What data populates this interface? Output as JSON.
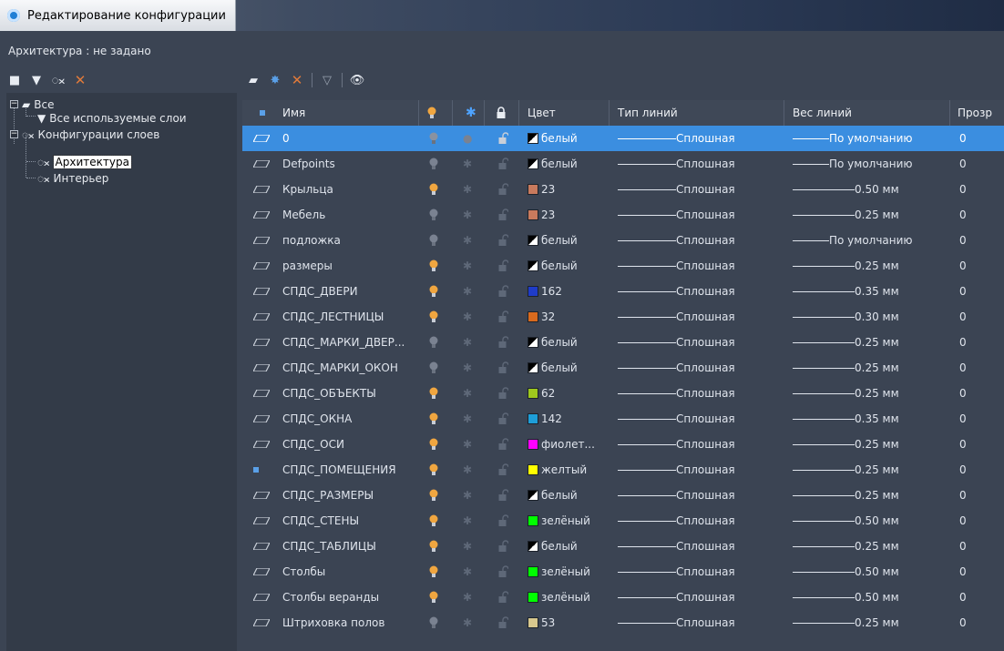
{
  "window": {
    "title": "Редактирование конфигурации"
  },
  "architecture_label": "Архитектура : не задано",
  "tree": {
    "all": "Все",
    "all_used": "Все используемые слои",
    "configs": "Конфигурации слоев",
    "arch": "Архитектура",
    "interior": "Интерьер"
  },
  "columns": {
    "name": "Имя",
    "color": "Цвет",
    "linetype": "Тип линий",
    "lineweight": "Вес линий",
    "transparency": "Прозр"
  },
  "colors": {
    "accent": "#3b8ee0",
    "bulb_on": "#f0a640",
    "bulb_off": "#7a8291"
  },
  "layers": [
    {
      "name": "0",
      "on": false,
      "color_name": "белый",
      "swatch": "#ffffff",
      "linetype": "Сплошная",
      "lineweight": "По умолчанию",
      "transp": "0",
      "selected": true,
      "current": false
    },
    {
      "name": "Defpoints",
      "on": false,
      "color_name": "белый",
      "swatch": "#ffffff",
      "linetype": "Сплошная",
      "lineweight": "По умолчанию",
      "transp": "0",
      "selected": false,
      "current": false
    },
    {
      "name": "Крыльца",
      "on": true,
      "color_name": "23",
      "swatch": "#c87a5d",
      "linetype": "Сплошная",
      "lineweight": "0.50 мм",
      "transp": "0",
      "selected": false,
      "current": false
    },
    {
      "name": "Мебель",
      "on": false,
      "color_name": "23",
      "swatch": "#c87a5d",
      "linetype": "Сплошная",
      "lineweight": "0.25 мм",
      "transp": "0",
      "selected": false,
      "current": false
    },
    {
      "name": "подложка",
      "on": false,
      "color_name": "белый",
      "swatch": "#ffffff",
      "linetype": "Сплошная",
      "lineweight": "По умолчанию",
      "transp": "0",
      "selected": false,
      "current": false
    },
    {
      "name": "размеры",
      "on": true,
      "color_name": "белый",
      "swatch": "#ffffff",
      "linetype": "Сплошная",
      "lineweight": "0.25 мм",
      "transp": "0",
      "selected": false,
      "current": false
    },
    {
      "name": "СПДС_ДВЕРИ",
      "on": true,
      "color_name": "162",
      "swatch": "#1f3cc8",
      "linetype": "Сплошная",
      "lineweight": "0.35 мм",
      "transp": "0",
      "selected": false,
      "current": false
    },
    {
      "name": "СПДС_ЛЕСТНИЦЫ",
      "on": true,
      "color_name": "32",
      "swatch": "#d86a1e",
      "linetype": "Сплошная",
      "lineweight": "0.30 мм",
      "transp": "0",
      "selected": false,
      "current": false
    },
    {
      "name": "СПДС_МАРКИ_ДВЕР...",
      "on": false,
      "color_name": "белый",
      "swatch": "#ffffff",
      "linetype": "Сплошная",
      "lineweight": "0.25 мм",
      "transp": "0",
      "selected": false,
      "current": false
    },
    {
      "name": "СПДС_МАРКИ_ОКОН",
      "on": false,
      "color_name": "белый",
      "swatch": "#ffffff",
      "linetype": "Сплошная",
      "lineweight": "0.25 мм",
      "transp": "0",
      "selected": false,
      "current": false
    },
    {
      "name": "СПДС_ОБЪЕКТЫ",
      "on": true,
      "color_name": "62",
      "swatch": "#9ec81e",
      "linetype": "Сплошная",
      "lineweight": "0.25 мм",
      "transp": "0",
      "selected": false,
      "current": false
    },
    {
      "name": "СПДС_ОКНА",
      "on": true,
      "color_name": "142",
      "swatch": "#1e9ed8",
      "linetype": "Сплошная",
      "lineweight": "0.35 мм",
      "transp": "0",
      "selected": false,
      "current": false
    },
    {
      "name": "СПДС_ОСИ",
      "on": true,
      "color_name": "фиолет...",
      "swatch": "#ff00ff",
      "linetype": "Сплошная",
      "lineweight": "0.25 мм",
      "transp": "0",
      "selected": false,
      "current": false
    },
    {
      "name": "СПДС_ПОМЕЩЕНИЯ",
      "on": true,
      "color_name": "желтый",
      "swatch": "#ffff00",
      "linetype": "Сплошная",
      "lineweight": "0.25 мм",
      "transp": "0",
      "selected": false,
      "current": true
    },
    {
      "name": "СПДС_РАЗМЕРЫ",
      "on": true,
      "color_name": "белый",
      "swatch": "#ffffff",
      "linetype": "Сплошная",
      "lineweight": "0.25 мм",
      "transp": "0",
      "selected": false,
      "current": false
    },
    {
      "name": "СПДС_СТЕНЫ",
      "on": true,
      "color_name": "зелёный",
      "swatch": "#00ff00",
      "linetype": "Сплошная",
      "lineweight": "0.50 мм",
      "transp": "0",
      "selected": false,
      "current": false
    },
    {
      "name": "СПДС_ТАБЛИЦЫ",
      "on": true,
      "color_name": "белый",
      "swatch": "#ffffff",
      "linetype": "Сплошная",
      "lineweight": "0.25 мм",
      "transp": "0",
      "selected": false,
      "current": false
    },
    {
      "name": "Столбы",
      "on": true,
      "color_name": "зелёный",
      "swatch": "#00ff00",
      "linetype": "Сплошная",
      "lineweight": "0.50 мм",
      "transp": "0",
      "selected": false,
      "current": false
    },
    {
      "name": "Столбы веранды",
      "on": true,
      "color_name": "зелёный",
      "swatch": "#00ff00",
      "linetype": "Сплошная",
      "lineweight": "0.50 мм",
      "transp": "0",
      "selected": false,
      "current": false
    },
    {
      "name": "Штриховка полов",
      "on": false,
      "color_name": "53",
      "swatch": "#d8c88e",
      "linetype": "Сплошная",
      "lineweight": "0.25 мм",
      "transp": "0",
      "selected": false,
      "current": false
    }
  ]
}
